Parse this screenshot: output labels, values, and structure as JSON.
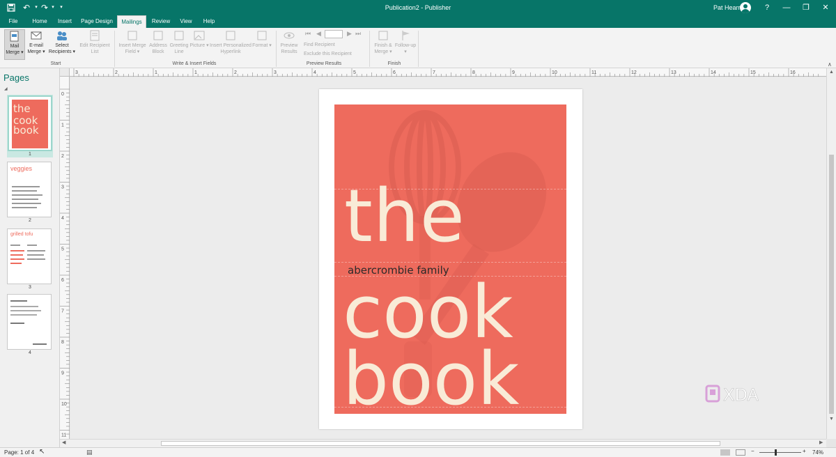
{
  "app": {
    "doc_title": "Publication2 - Publisher",
    "user_name": "Pat Hearn",
    "help_label": "?",
    "accent": "#077568"
  },
  "quick_access": {
    "save_icon": "save-icon",
    "undo_icon": "undo-icon",
    "redo_icon": "redo-icon",
    "customize_icon": "customize-icon"
  },
  "tabs": [
    "File",
    "Home",
    "Insert",
    "Page Design",
    "Mailings",
    "Review",
    "View",
    "Help"
  ],
  "active_tab": "Mailings",
  "ribbon": {
    "mail_merge": "Mail Merge",
    "email_merge": "E-mail Merge",
    "select_recipients": "Select Recipients",
    "edit_recipient_list": "Edit Recipient List",
    "insert_merge_field": "Insert Merge Field",
    "address_block": "Address Block",
    "greeting_line": "Greeting Line",
    "picture": "Picture",
    "insert_personalized_hyperlink": "Insert Personalized Hyperlink",
    "format": "Format",
    "preview_results": "Preview Results",
    "find_recipient": "Find Recipient",
    "exclude_recipient": "Exclude this Recipient",
    "finish_merge": "Finish & Merge",
    "follow_up": "Follow-up",
    "groups": {
      "start": "Start",
      "write_insert": "Write & Insert Fields",
      "preview": "Preview Results",
      "finish": "Finish"
    }
  },
  "pages_pane": {
    "title": "Pages",
    "thumbnails": [
      {
        "num": "1",
        "title_lines": [
          "the",
          "cook",
          "book"
        ]
      },
      {
        "num": "2",
        "title": "veggies"
      },
      {
        "num": "3",
        "title": "grilled tofu"
      },
      {
        "num": "4"
      }
    ]
  },
  "cover": {
    "word1": "the",
    "family": "abercrombie family",
    "word2": "cook",
    "word3": "book",
    "bg_color": "#ee6b5d",
    "text_color": "#f9ebd7"
  },
  "ruler": {
    "h_labels": [
      "3",
      "2",
      "1",
      "1",
      "2",
      "3",
      "4",
      "5",
      "6",
      "7",
      "8",
      "9",
      "10",
      "11",
      "12",
      "13",
      "14",
      "15",
      "16"
    ],
    "v_labels": [
      "0",
      "1",
      "2",
      "3",
      "4",
      "5",
      "6",
      "7",
      "8",
      "9",
      "10",
      "11"
    ]
  },
  "status": {
    "page_info": "Page: 1 of 4",
    "zoom": "74%"
  },
  "watermark": "XDA"
}
